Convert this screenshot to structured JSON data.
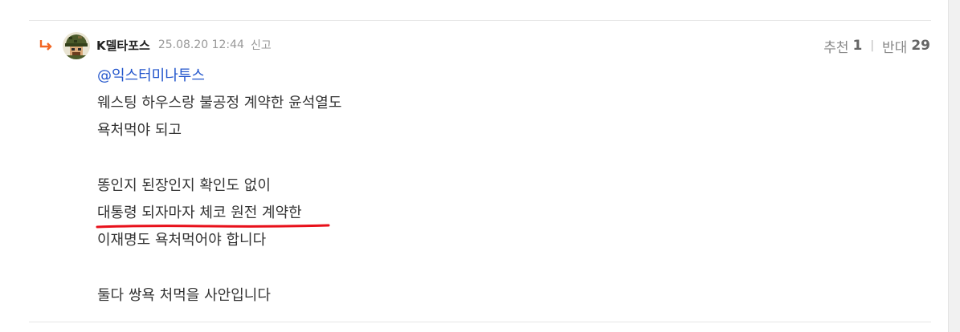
{
  "comment": {
    "nickname": "K델타포스",
    "date": "25.08.20 12:44",
    "report_label": "신고",
    "votes": {
      "up_label": "추천",
      "up_count": "1",
      "down_label": "반대",
      "down_count": "29"
    },
    "mention": "@익스터미나투스",
    "lines": [
      "웨스팅 하우스랑 불공정 계약한 윤석열도",
      "욕처먹야 되고",
      "",
      "똥인지 된장인지 확인도 없이",
      "대통령 되자마자 체코 원전 계약한",
      "이재명도 욕처먹어야 합니다",
      "",
      "둘다 쌍욕 처먹을 사안입니다"
    ]
  },
  "colors": {
    "accent_reply_arrow": "#f26522",
    "mention": "#2255cc",
    "highlight_underline": "#e8101a"
  }
}
